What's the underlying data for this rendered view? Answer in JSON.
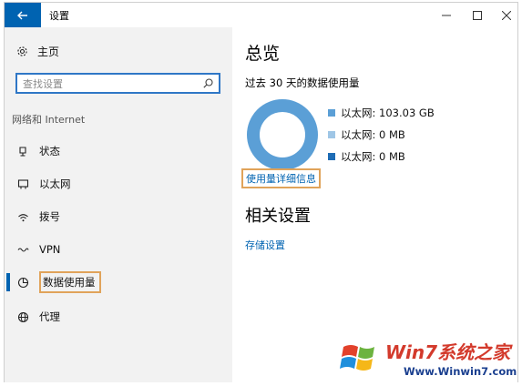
{
  "window": {
    "title": "设置"
  },
  "sidebar": {
    "home_label": "主页",
    "search_placeholder": "查找设置",
    "section_label": "网络和 Internet",
    "items": [
      {
        "label": "状态",
        "icon": "status-icon"
      },
      {
        "label": "以太网",
        "icon": "ethernet-icon"
      },
      {
        "label": "拨号",
        "icon": "dialup-icon"
      },
      {
        "label": "VPN",
        "icon": "vpn-icon"
      },
      {
        "label": "数据使用量",
        "icon": "data-usage-icon",
        "active": true
      },
      {
        "label": "代理",
        "icon": "proxy-icon"
      }
    ]
  },
  "main": {
    "overview_title": "总览",
    "period_label": "过去 30 天的数据使用量",
    "legend": [
      {
        "label": "以太网: 103.03 GB",
        "color": "#5b9fd6"
      },
      {
        "label": "以太网: 0 MB",
        "color": "#9fc6e6"
      },
      {
        "label": "以太网: 0 MB",
        "color": "#1e6cb5"
      }
    ],
    "detail_link": "使用量详细信息",
    "related_title": "相关设置",
    "storage_link": "存储设置"
  },
  "watermark": {
    "title": "Win7系统之家",
    "url": "Www.Winwin7.com"
  },
  "colors": {
    "accent": "#0063b1",
    "highlight_frame": "#e0a35a",
    "sidebar_bg": "#f2f2f2"
  }
}
